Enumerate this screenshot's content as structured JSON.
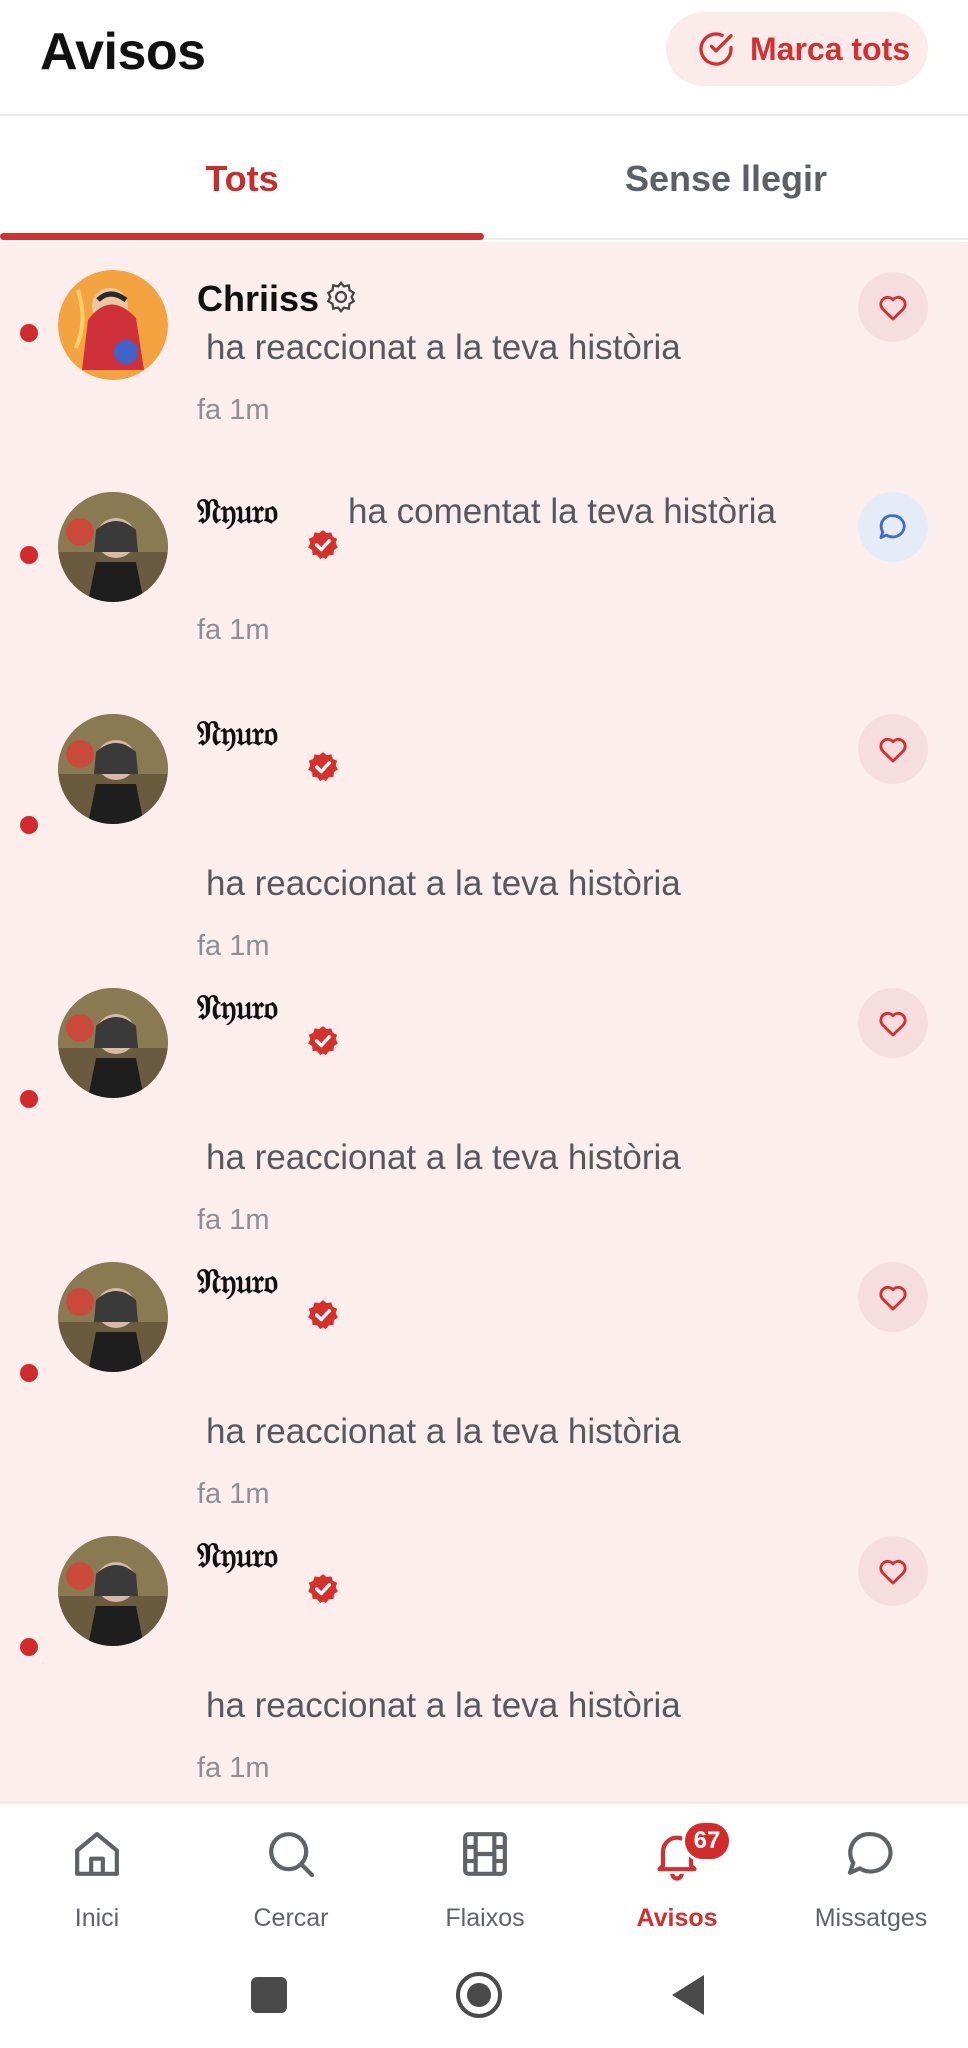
{
  "header": {
    "title": "Avisos",
    "mark_all_label": "Marca tots"
  },
  "tabs": [
    {
      "label": "Tots",
      "active": true
    },
    {
      "label": "Sense llegir",
      "active": false
    }
  ],
  "notifications": [
    {
      "user": "Chriiss",
      "action": "ha reaccionat a la teva història",
      "time": "fa 1m",
      "type": "heart"
    },
    {
      "user": "𝔑𝔶𝔲𝔯𝔬",
      "action": "ha comentat la teva història",
      "time": "fa 1m",
      "type": "comment"
    },
    {
      "user": "𝔑𝔶𝔲𝔯𝔬",
      "action": "ha reaccionat a la teva història",
      "time": "fa 1m",
      "type": "heart"
    },
    {
      "user": "𝔑𝔶𝔲𝔯𝔬",
      "action": "ha reaccionat a la teva història",
      "time": "fa 1m",
      "type": "heart"
    },
    {
      "user": "𝔑𝔶𝔲𝔯𝔬",
      "action": "ha reaccionat a la teva història",
      "time": "fa 1m",
      "type": "heart"
    },
    {
      "user": "𝔑𝔶𝔲𝔯𝔬",
      "action": "ha reaccionat a la teva història",
      "time": "fa 1m",
      "type": "heart"
    }
  ],
  "bottom_nav": [
    {
      "label": "Inici",
      "icon": "home-icon"
    },
    {
      "label": "Cercar",
      "icon": "search-icon"
    },
    {
      "label": "Flaixos",
      "icon": "film-icon"
    },
    {
      "label": "Avisos",
      "icon": "bell-icon",
      "badge": "67",
      "active": true
    },
    {
      "label": "Missatges",
      "icon": "chat-icon"
    }
  ],
  "colors": {
    "accent": "#d32f2f",
    "unread_bg": "#fdeeee"
  }
}
